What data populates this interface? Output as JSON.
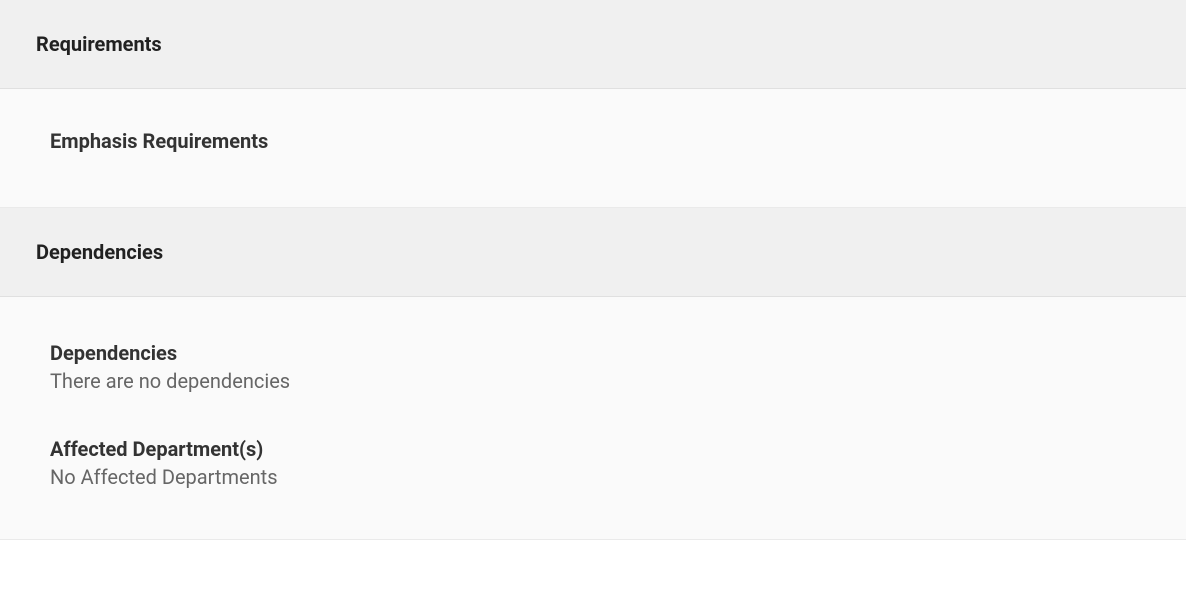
{
  "requirements": {
    "header": "Requirements",
    "emphasis_label": "Emphasis Requirements"
  },
  "dependencies": {
    "header": "Dependencies",
    "dependencies_label": "Dependencies",
    "dependencies_value": "There are no dependencies",
    "affected_departments_label": "Affected Department(s)",
    "affected_departments_value": "No Affected Departments"
  }
}
